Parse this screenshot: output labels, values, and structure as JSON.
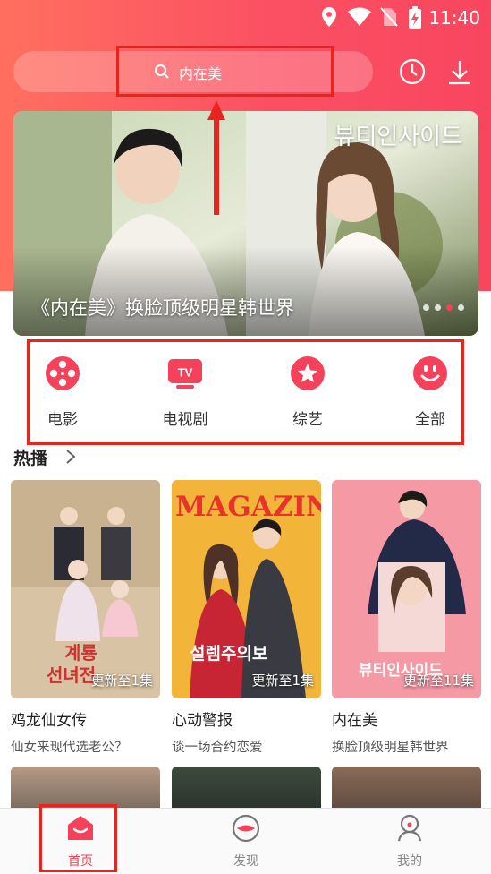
{
  "status_bar": {
    "time": "11:40"
  },
  "search": {
    "query": "内在美"
  },
  "banner": {
    "caption": "《内在美》换脸顶级明星韩世界",
    "korean_title": "뷰티인사이드",
    "dots": 4,
    "active_dot": 3
  },
  "categories": [
    {
      "label": "电影",
      "icon": "film-reel-icon"
    },
    {
      "label": "电视剧",
      "icon": "tv-icon"
    },
    {
      "label": "综艺",
      "icon": "star-icon"
    },
    {
      "label": "全部",
      "icon": "smiley-icon"
    }
  ],
  "section": {
    "title": "热播"
  },
  "cards": [
    {
      "title": "鸡龙仙女传",
      "subtitle": "仙女来现代选老公？",
      "update": "更新至1集",
      "poster_text": "계룡\n선녀전"
    },
    {
      "title": "心动警报",
      "subtitle": "谈一场合约恋爱",
      "update": "更新至1集",
      "poster_text": "MAGAZINE"
    },
    {
      "title": "内在美",
      "subtitle": "换脸顶级明星韩世界",
      "update": "更新至11集",
      "poster_text": "뷰티인사이드"
    }
  ],
  "tabs": [
    {
      "label": "首页",
      "icon": "home-icon",
      "active": true
    },
    {
      "label": "发现",
      "icon": "discover-icon",
      "active": false
    },
    {
      "label": "我的",
      "icon": "profile-icon",
      "active": false
    }
  ],
  "colors": {
    "accent": "#f8465f",
    "highlight_box": "#e8241f"
  }
}
